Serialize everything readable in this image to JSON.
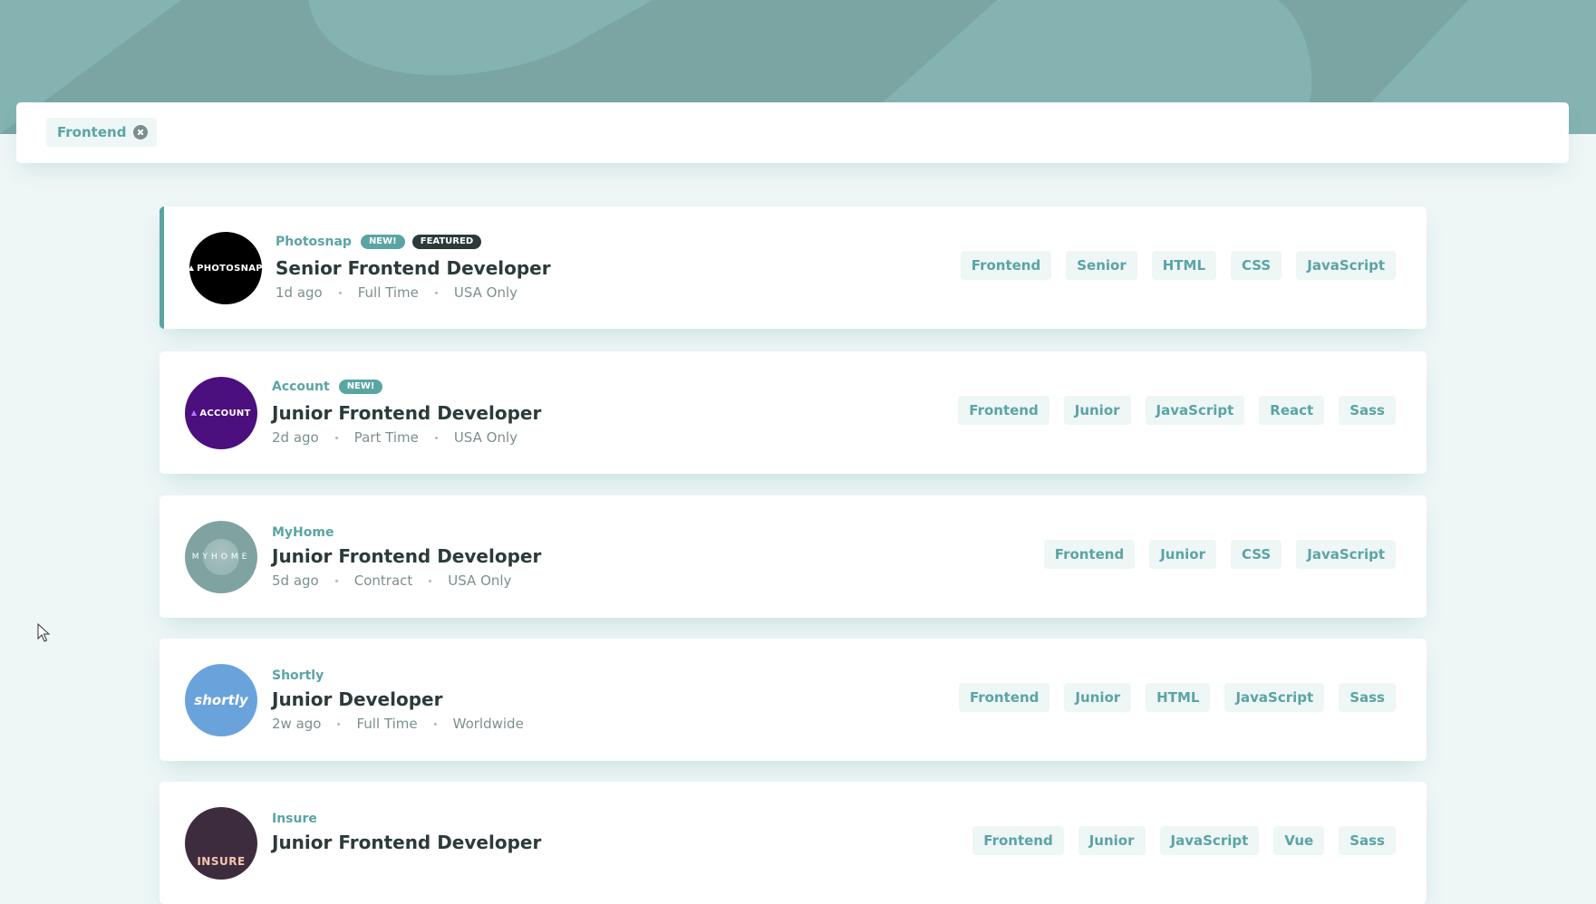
{
  "colors": {
    "primary": "#5ba4a4",
    "header_bg": "#7aa5a3",
    "page_bg": "#eef6f6",
    "text_dark": "#2c3a3a",
    "text_muted": "#7c8f8f"
  },
  "filter": {
    "tags": [
      "Frontend"
    ]
  },
  "jobs": [
    {
      "company": "Photosnap",
      "logo_text": "PHOTOSNAP",
      "new_label": "NEW!",
      "featured_label": "FEATURED",
      "position": "Senior Frontend Developer",
      "posted": "1d ago",
      "contract": "Full Time",
      "location": "USA Only",
      "tags": [
        "Frontend",
        "Senior",
        "HTML",
        "CSS",
        "JavaScript"
      ]
    },
    {
      "company": "Account",
      "logo_text": "ACCOUNT",
      "new_label": "NEW!",
      "position": "Junior Frontend Developer",
      "posted": "2d ago",
      "contract": "Part Time",
      "location": "USA Only",
      "tags": [
        "Frontend",
        "Junior",
        "JavaScript",
        "React",
        "Sass"
      ]
    },
    {
      "company": "MyHome",
      "logo_text": "MYHOME",
      "position": "Junior Frontend Developer",
      "posted": "5d ago",
      "contract": "Contract",
      "location": "USA Only",
      "tags": [
        "Frontend",
        "Junior",
        "CSS",
        "JavaScript"
      ]
    },
    {
      "company": "Shortly",
      "logo_text": "shortly",
      "position": "Junior Developer",
      "posted": "2w ago",
      "contract": "Full Time",
      "location": "Worldwide",
      "tags": [
        "Frontend",
        "Junior",
        "HTML",
        "JavaScript",
        "Sass"
      ]
    },
    {
      "company": "Insure",
      "logo_text": "INSURE",
      "position": "Junior Frontend Developer",
      "tags": [
        "Frontend",
        "Junior",
        "JavaScript",
        "Vue",
        "Sass"
      ]
    }
  ]
}
